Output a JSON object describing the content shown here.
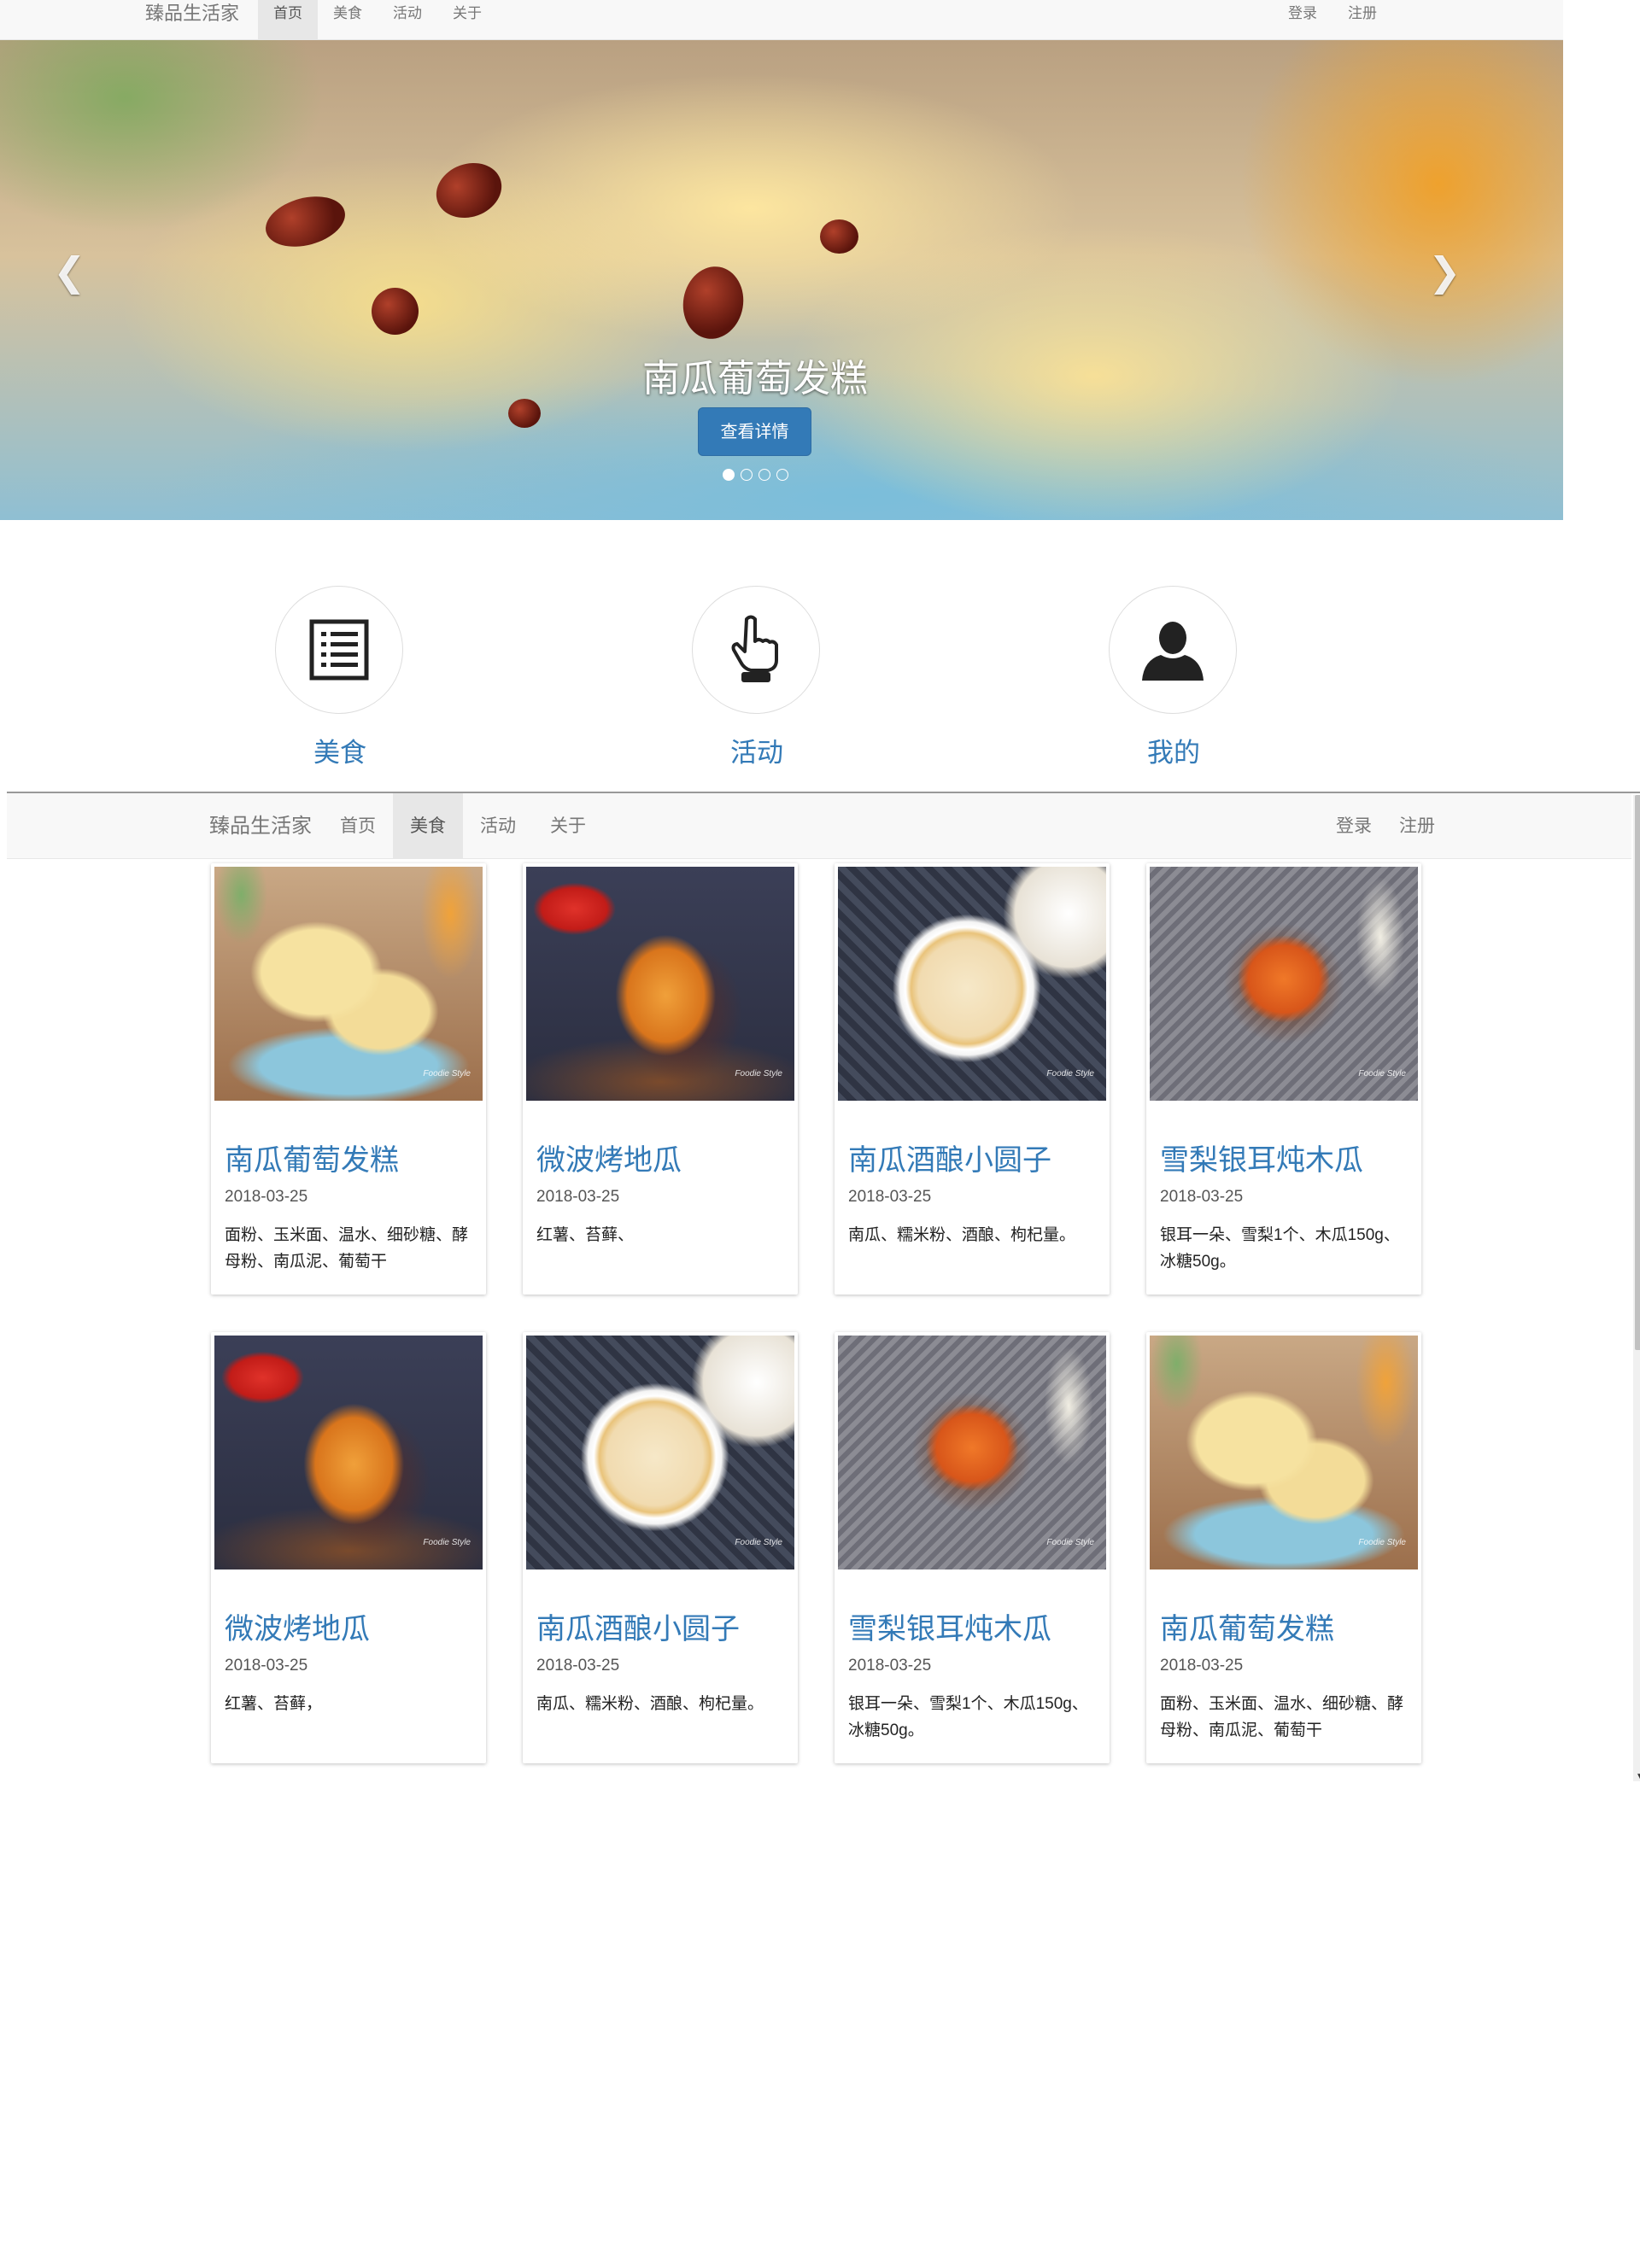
{
  "top_navbar": {
    "brand": "臻品生活家",
    "nav": [
      "首页",
      "美食",
      "活动",
      "关于"
    ],
    "active_index": 0,
    "right": [
      "登录",
      "注册"
    ]
  },
  "carousel": {
    "caption": "南瓜葡萄发糕",
    "button_label": "查看详情",
    "prev_icon": "chevron-left-icon",
    "next_icon": "chevron-right-icon",
    "slide_count": 4,
    "active_slide": 1
  },
  "features": [
    {
      "label": "美食",
      "icon": "list-icon"
    },
    {
      "label": "活动",
      "icon": "hand-pointer-icon"
    },
    {
      "label": "我的",
      "icon": "user-icon"
    }
  ],
  "inner_navbar": {
    "brand": "臻品生活家",
    "nav": [
      "首页",
      "美食",
      "活动",
      "关于"
    ],
    "active_index": 1,
    "right": [
      "登录",
      "注册"
    ]
  },
  "cards": [
    {
      "title": "南瓜葡萄发糕",
      "date": "2018-03-25",
      "desc": "面粉、玉米面、温水、细砂糖、酵母粉、南瓜泥、葡萄干",
      "image": "cake"
    },
    {
      "title": "微波烤地瓜",
      "date": "2018-03-25",
      "desc": "红薯、苔藓、",
      "image": "potato"
    },
    {
      "title": "南瓜酒酿小圆子",
      "date": "2018-03-25",
      "desc": "南瓜、糯米粉、酒酿、枸杞量。",
      "image": "soup"
    },
    {
      "title": "雪梨银耳炖木瓜",
      "date": "2018-03-25",
      "desc": "银耳一朵、雪梨1个、木瓜150g、冰糖50g。",
      "image": "papaya"
    },
    {
      "title": "微波烤地瓜",
      "date": "2018-03-25",
      "desc": "红薯、苔藓，",
      "image": "potato"
    },
    {
      "title": "南瓜酒酿小圆子",
      "date": "2018-03-25",
      "desc": "南瓜、糯米粉、酒酿、枸杞量。",
      "image": "soup"
    },
    {
      "title": "雪梨银耳炖木瓜",
      "date": "2018-03-25",
      "desc": "银耳一朵、雪梨1个、木瓜150g、冰糖50g。",
      "image": "papaya"
    },
    {
      "title": "南瓜葡萄发糕",
      "date": "2018-03-25",
      "desc": "面粉、玉米面、温水、细砂糖、酵母粉、南瓜泥、葡萄干",
      "image": "cake"
    }
  ],
  "image_watermark": "Foodie Style",
  "colors": {
    "link": "#337ab7",
    "navbar_bg": "#f8f8f8",
    "button": "#337ab7"
  }
}
